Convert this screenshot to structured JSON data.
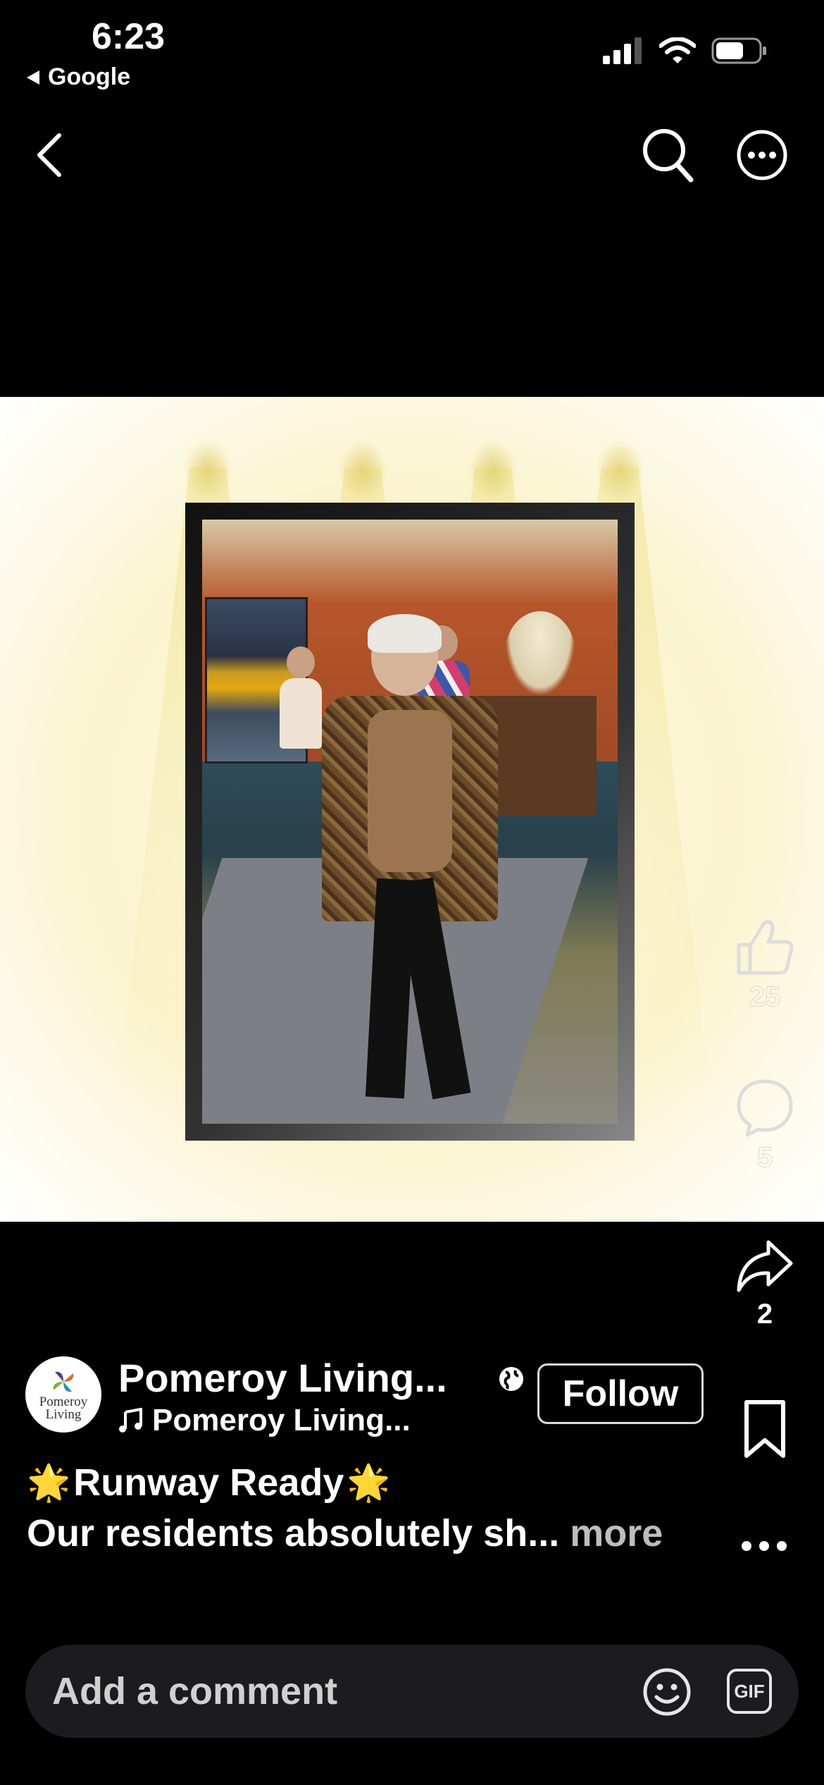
{
  "status_bar": {
    "time": "6:23",
    "back_app_label": "Google",
    "icons": [
      "signal-icon",
      "wifi-icon",
      "battery-icon"
    ]
  },
  "top_nav": {
    "icons": [
      "back-chevron-icon",
      "search-icon",
      "more-options-icon"
    ]
  },
  "reactions": {
    "likes": "25",
    "comments": "5",
    "shares": "2"
  },
  "author": {
    "name": "Pomeroy Living...",
    "avatar_text": "Pomeroy Living",
    "audio_label": "Pomeroy Living...",
    "follow_label": "Follow"
  },
  "caption": {
    "line1": "Runway Ready",
    "line2": "Our residents absolutely sh... ",
    "more_label": "more",
    "star_emoji": "🌟"
  },
  "comment_input": {
    "placeholder": "Add a comment",
    "gif_label": "GIF"
  },
  "colors": {
    "background": "#000000",
    "comment_box": "#1c1c1e",
    "more_text": "#bdbdbd"
  }
}
